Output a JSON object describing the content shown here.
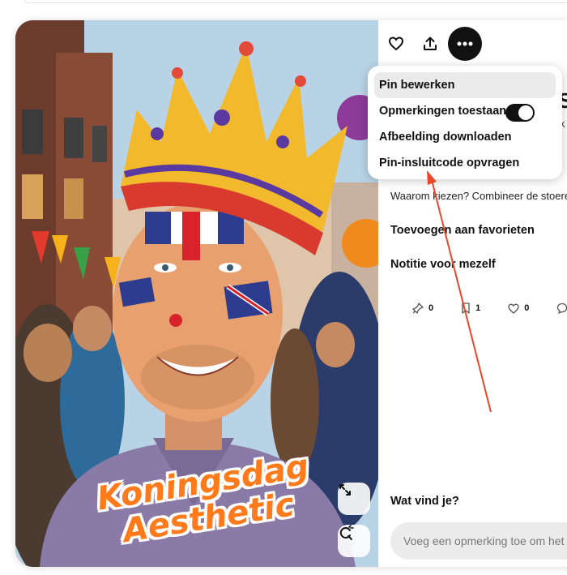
{
  "pin_image": {
    "overlay_line1": "Koningsdag",
    "overlay_line2": "Aesthetic",
    "expand_icon": "expand-arrows-icon",
    "visual_search_icon": "visual-search-icon"
  },
  "toolbar": {
    "like_icon": "heart-icon",
    "share_icon": "share-icon",
    "more_icon": "ellipsis-icon"
  },
  "pin_details": {
    "title_fragment": "S",
    "subtitle_fragment": "k",
    "description": "Waarom kiezen? Combineer de stoere",
    "add_to_favorites": "Toevoegen aan favorieten",
    "note_to_self": "Notitie voor mezelf",
    "stats": [
      {
        "icon": "pin-icon",
        "value": "0"
      },
      {
        "icon": "bookmark-icon",
        "value": "1"
      },
      {
        "icon": "heart-outline-icon",
        "value": "0"
      },
      {
        "icon": "comment-icon",
        "value": ""
      }
    ],
    "comments_heading": "Wat vind je?",
    "comment_placeholder": "Voeg een opmerking toe om het"
  },
  "more_menu": {
    "items": [
      {
        "label": "Pin bewerken",
        "highlighted": true
      },
      {
        "label": "Opmerkingen toestaan",
        "toggle_on": true
      },
      {
        "label": "Afbeelding downloaden"
      },
      {
        "label": "Pin-insluitcode opvragen"
      }
    ]
  },
  "colors": {
    "accent_dark": "#111111",
    "annotation_arrow": "#e8472a",
    "overlay_text": "#ff7a1a",
    "menu_highlight": "#ebebeb"
  }
}
